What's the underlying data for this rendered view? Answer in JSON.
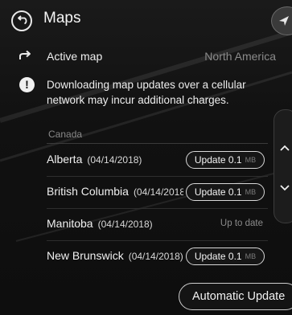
{
  "header": {
    "title": "Maps",
    "back_icon": "back-arrow-icon",
    "corner_icon": "navigate-arrow-icon"
  },
  "active_map": {
    "label": "Active map",
    "value": "North America",
    "icon": "share-arrow-icon"
  },
  "warning": {
    "icon": "exclamation-icon",
    "text": "Downloading map updates over a cellular network may incur additional charges."
  },
  "section": {
    "label": "Canada"
  },
  "rows": [
    {
      "name": "Alberta",
      "date": "(04/14/2018)",
      "action": "Update 0.1",
      "size": "MB"
    },
    {
      "name": "British Columbia",
      "date": "(04/14/2018)",
      "action": "Update 0.1",
      "size": "MB"
    },
    {
      "name": "Manitoba",
      "date": "(04/14/2018)",
      "status": "Up to date"
    },
    {
      "name": "New Brunswick",
      "date": "(04/14/2018)",
      "action": "Update 0.1",
      "size": "MB"
    }
  ],
  "scroll": {
    "up_icon": "chevron-up-icon",
    "down_icon": "chevron-down-icon"
  },
  "footer": {
    "auto_update_label": "Automatic Update"
  },
  "colors": {
    "background": "#111111",
    "text": "#f2f2f2",
    "muted": "#8b8b8b",
    "button_border": "#d8d8d8"
  }
}
